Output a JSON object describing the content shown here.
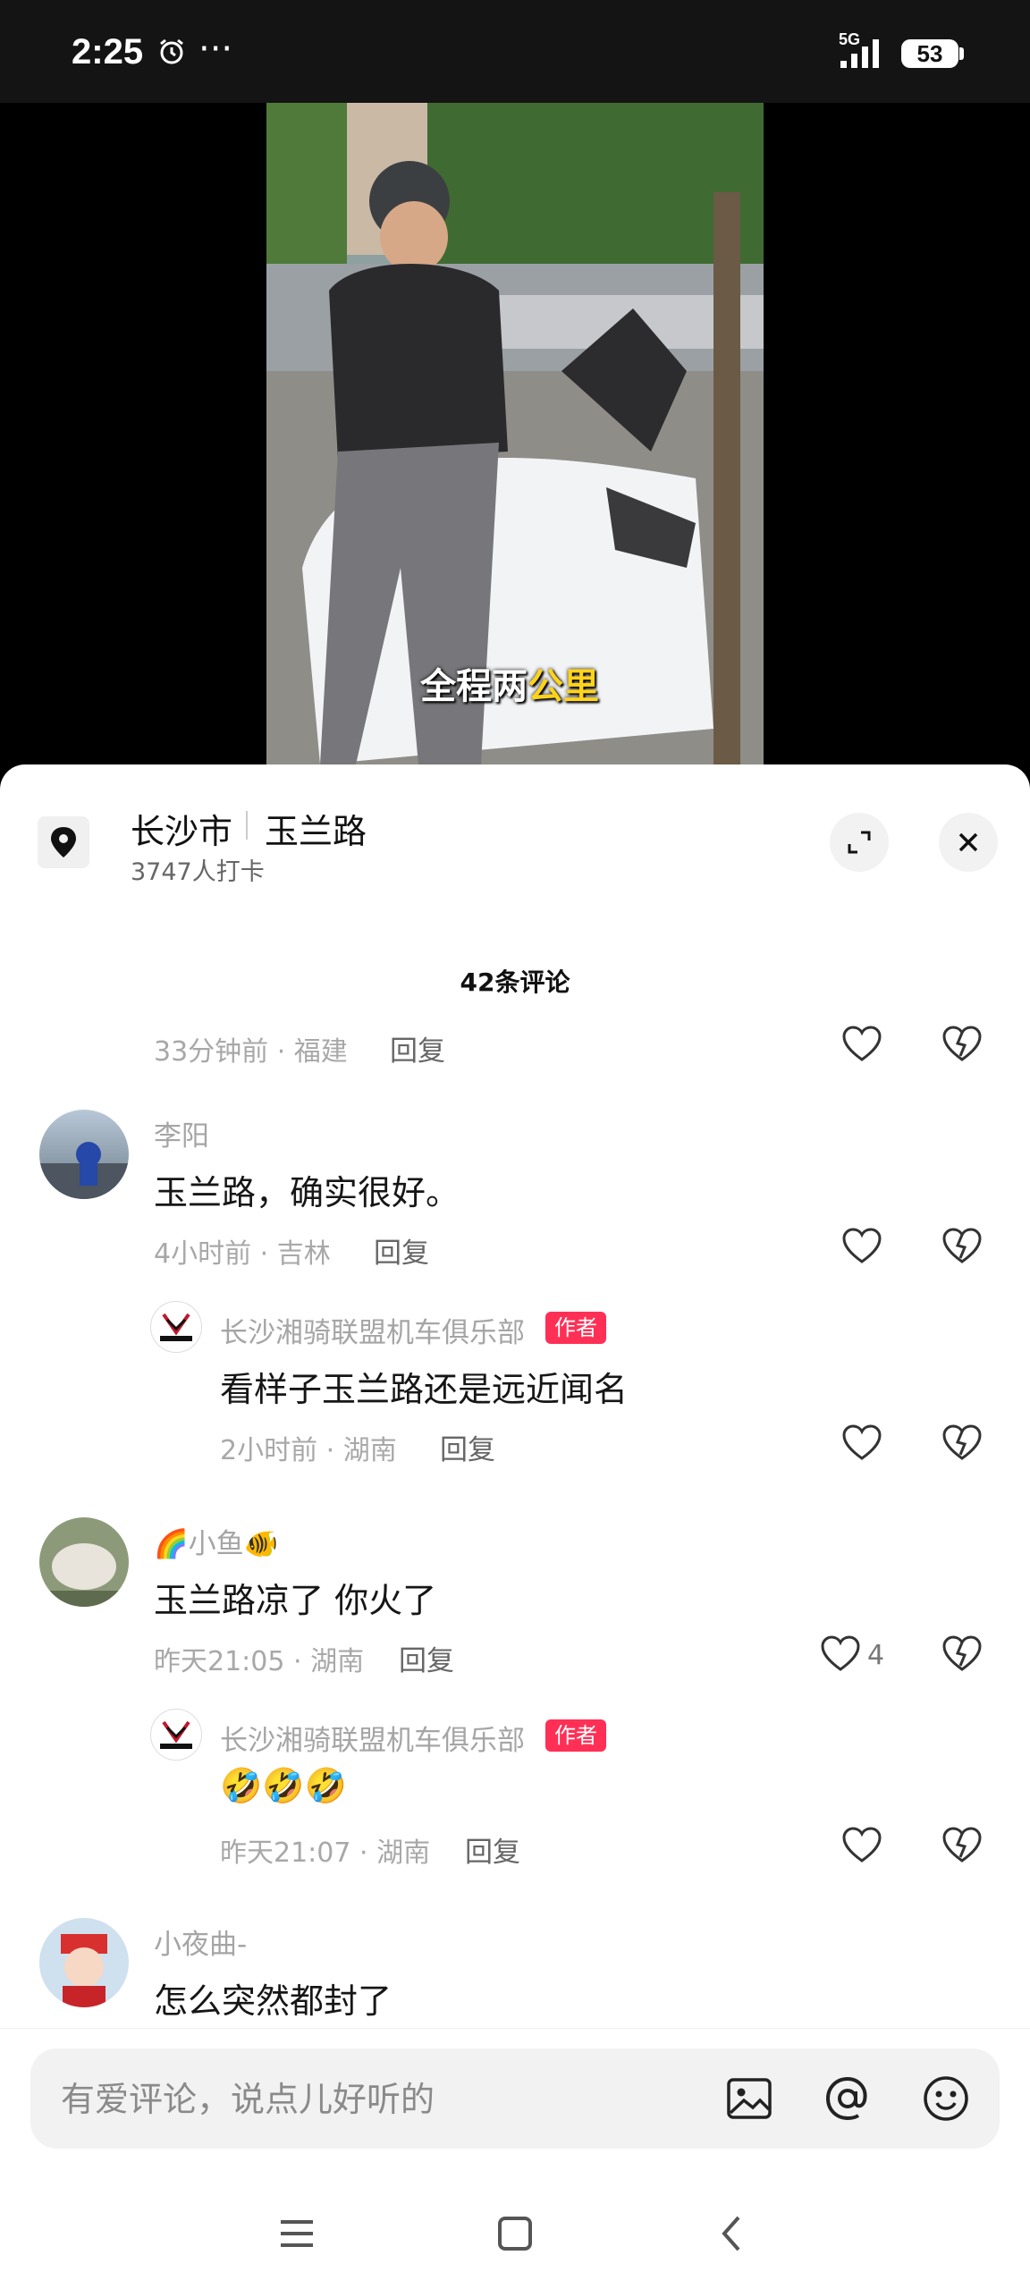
{
  "status_bar": {
    "time": "2:25",
    "network": "5G",
    "battery": "53"
  },
  "video": {
    "subtitle_main": "全程两",
    "subtitle_highlight": "公里"
  },
  "location": {
    "city": "长沙市",
    "road": "玉兰路",
    "checkins": "3747人打卡"
  },
  "comments_header": "42条评论",
  "reply_label": "回复",
  "author_badge": "作者",
  "comments": [
    {
      "meta": "33分钟前 · 福建"
    },
    {
      "user": "李阳",
      "text": "玉兰路，确实很好。",
      "meta": "4小时前 · 吉林",
      "reply": {
        "user": "长沙湘骑联盟机车俱乐部",
        "text": "看样子玉兰路还是远近闻名",
        "meta": "2小时前 · 湖南"
      }
    },
    {
      "user": "小鱼",
      "text": "玉兰路凉了 你火了",
      "meta": "昨天21:05 · 湖南",
      "likes": "4",
      "reply": {
        "user": "长沙湘骑联盟机车俱乐部",
        "text": "🤣🤣🤣",
        "meta": "昨天21:07 · 湖南"
      }
    },
    {
      "user": "小夜曲-",
      "text": "怎么突然都封了"
    }
  ],
  "input": {
    "placeholder": "有爱评论，说点儿好听的"
  },
  "icons": [
    "alarm-icon",
    "more-icon",
    "signal-icon",
    "battery-icon",
    "location-pin-icon",
    "expand-icon",
    "close-icon",
    "heart-icon",
    "dislike-heart-icon",
    "image-icon",
    "at-icon",
    "emoji-icon",
    "menu-nav-icon",
    "home-nav-icon",
    "back-nav-icon"
  ]
}
